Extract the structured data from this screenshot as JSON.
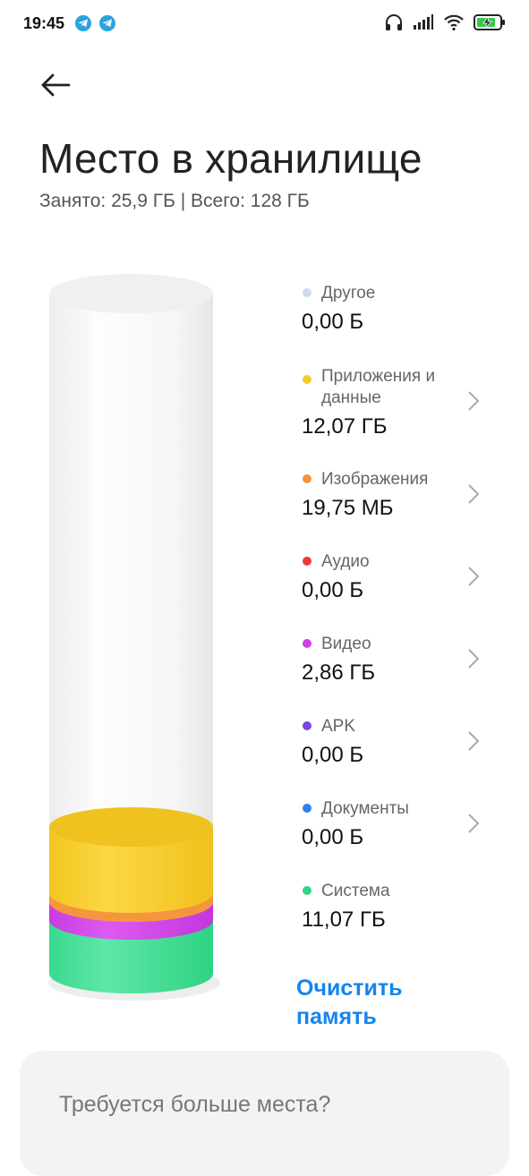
{
  "status_bar": {
    "time": "19:45",
    "battery_charging": true,
    "notifications": [
      "telegram-icon",
      "telegram-icon"
    ],
    "right_icons": [
      "headphones-icon",
      "signal-icon",
      "wifi-icon",
      "battery-icon"
    ]
  },
  "header": {
    "title": "Место в хранилище",
    "subtitle": "Занято: 25,9 ГБ | Всего: 128 ГБ"
  },
  "storage": {
    "items": [
      {
        "label": "Другое",
        "value": "0,00 Б",
        "color": "#d0d8ee",
        "has_chevron": false
      },
      {
        "label": "Приложения и данные",
        "value": "12,07 ГБ",
        "color": "#f3cb2c",
        "has_chevron": true
      },
      {
        "label": "Изображения",
        "value": "19,75 МБ",
        "color": "#f7913a",
        "has_chevron": true
      },
      {
        "label": "Аудио",
        "value": "0,00 Б",
        "color": "#ee3a3a",
        "has_chevron": true
      },
      {
        "label": "Видео",
        "value": "2,86 ГБ",
        "color": "#cf40e8",
        "has_chevron": true
      },
      {
        "label": "APK",
        "value": "0,00 Б",
        "color": "#7a44e0",
        "has_chevron": true
      },
      {
        "label": "Документы",
        "value": "0,00 Б",
        "color": "#2d7ff0",
        "has_chevron": true
      },
      {
        "label": "Система",
        "value": "11,07 ГБ",
        "color": "#34d58a",
        "has_chevron": false
      }
    ]
  },
  "actions": {
    "clean_label": "Очистить память"
  },
  "more_space": {
    "title": "Требуется больше места?"
  }
}
